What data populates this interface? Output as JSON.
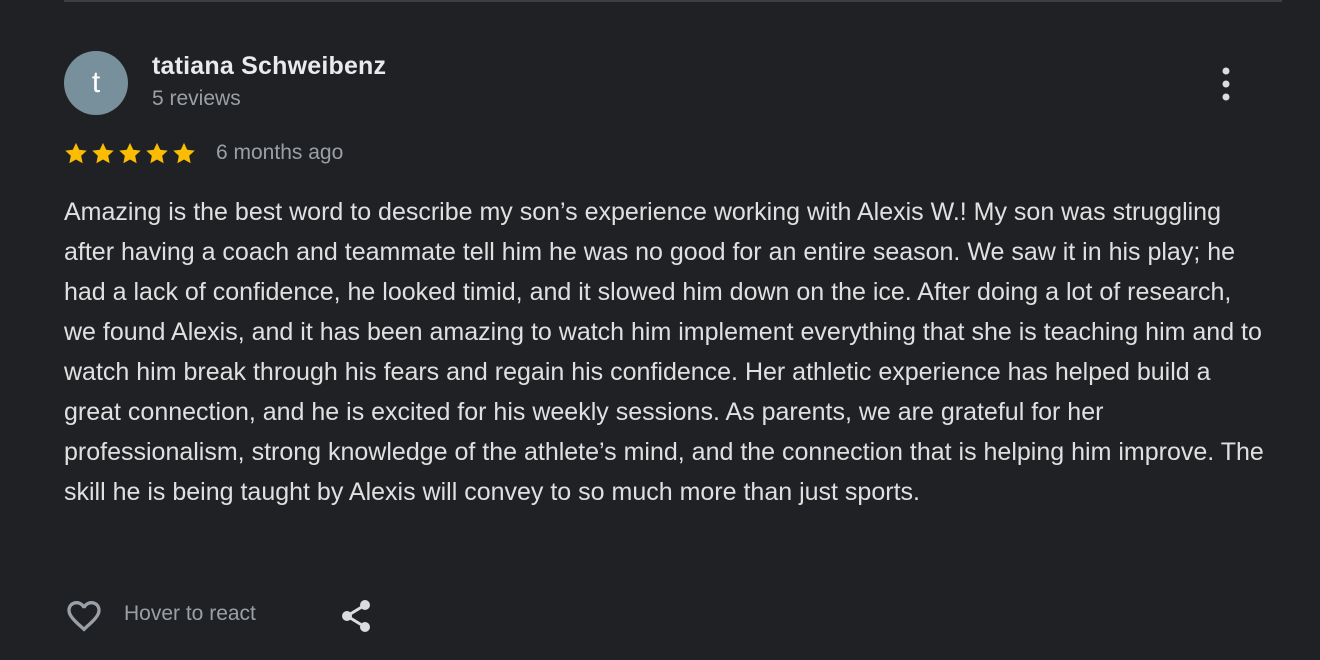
{
  "review": {
    "avatar_initial": "t",
    "avatar_color": "#78909c",
    "reviewer_name": "tatiana Schweibenz",
    "reviewer_meta": "5 reviews",
    "rating": 5,
    "rating_max": 5,
    "star_color": "#fbbc04",
    "time": "6 months ago",
    "text": "Amazing is the best word to describe my son’s experience working with Alexis W.! My son was struggling after having a coach and teammate tell him he was no good for an entire season. We saw it in his play; he had a lack of confidence, he looked timid, and it slowed him down on the ice. After doing a lot of research, we found Alexis, and it has been amazing to watch him implement everything that she is teaching him and to watch him break through his fears and regain his confidence. Her athletic experience has helped build a great connection, and he is excited for his weekly sessions. As parents, we are grateful for her professionalism, strong knowledge of the athlete’s mind, and the connection that is helping him improve. The skill he is being taught by Alexis will convey to so much more than just sports."
  },
  "actions": {
    "react_label": "Hover to react",
    "like_icon": "heart-outline-icon",
    "share_icon": "share-icon",
    "more_icon": "more-vertical-icon"
  },
  "theme": {
    "background": "#202124",
    "primary_text": "#e8eaed",
    "secondary_text": "#9aa0a6"
  }
}
